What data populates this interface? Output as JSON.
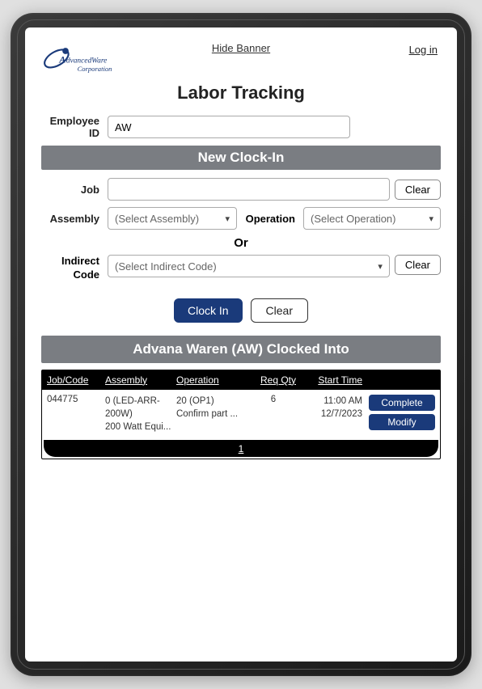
{
  "header": {
    "hide_banner": "Hide Banner",
    "login": "Log in",
    "page_title": "Labor Tracking",
    "logo_line1": "dvancedWare",
    "logo_line2": "Corporation"
  },
  "form": {
    "employee_id_label": "Employee ID",
    "employee_id_value": "AW",
    "new_clockin_header": "New Clock-In",
    "job_label": "Job",
    "clear_label": "Clear",
    "assembly_label": "Assembly",
    "assembly_placeholder": "(Select Assembly)",
    "operation_label": "Operation",
    "operation_placeholder": "(Select Operation)",
    "or_label": "Or",
    "indirect_label_line1": "Indirect",
    "indirect_label_line2": "Code",
    "indirect_placeholder": "(Select Indirect Code)",
    "clockin_btn": "Clock In",
    "clear_btn": "Clear"
  },
  "clocked": {
    "header": "Advana Waren (AW) Clocked Into",
    "columns": {
      "job": "Job/Code",
      "assembly": "Assembly",
      "operation": "Operation",
      "req_qty": "Req Qty",
      "start_time": "Start Time"
    },
    "row": {
      "job": "044775",
      "asm_line1": "0 (LED-ARR-200W)",
      "asm_line2": "200 Watt Equi...",
      "op_line1": "20 (OP1)",
      "op_line2": "Confirm part ...",
      "req_qty": "6",
      "start_time": "11:00 AM",
      "start_date": "12/7/2023",
      "complete_btn": "Complete",
      "modify_btn": "Modify"
    },
    "page_number": "1"
  }
}
